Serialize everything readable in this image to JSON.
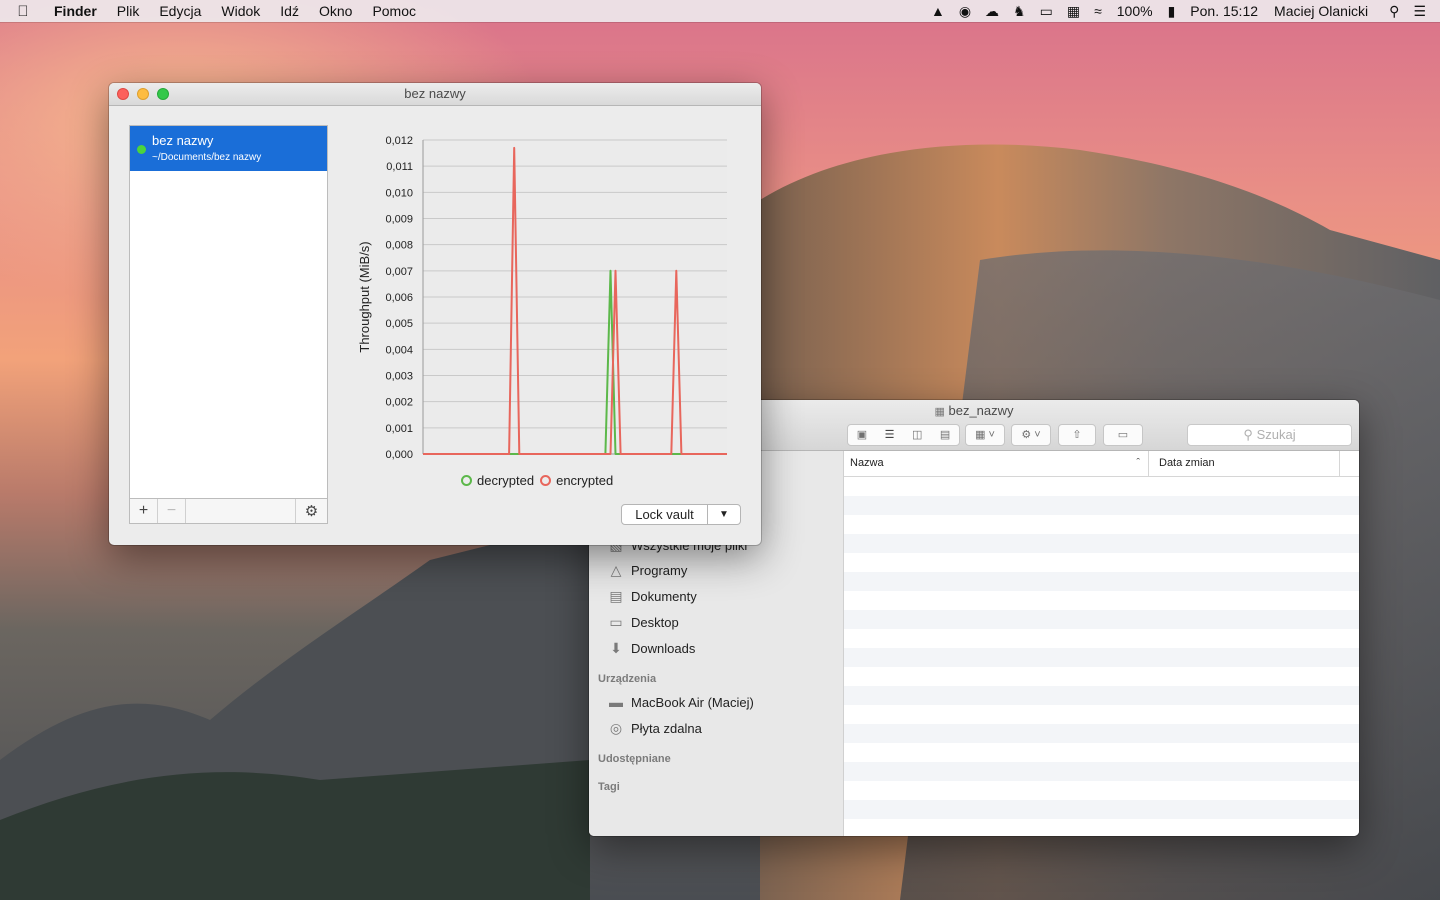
{
  "menubar": {
    "app": "Finder",
    "items": [
      "Plik",
      "Edycja",
      "Widok",
      "Idź",
      "Okno",
      "Pomoc"
    ],
    "battery": "100%",
    "clock": "Pon. 15:12",
    "user": "Maciej Olanicki"
  },
  "crypto": {
    "title": "bez nazwy",
    "vault": {
      "name": "bez nazwy",
      "path": "~/Documents/bez nazwy",
      "status_color": "#4bd43d"
    },
    "lock_label": "Lock vault",
    "add_label": "+",
    "remove_label": "−"
  },
  "chart_data": {
    "type": "line",
    "ylabel": "Throughput (MiB/s)",
    "xlabel": "",
    "ylim": [
      0,
      0.012
    ],
    "yticks": [
      "0,012",
      "0,011",
      "0,010",
      "0,009",
      "0,008",
      "0,007",
      "0,006",
      "0,005",
      "0,004",
      "0,003",
      "0,002",
      "0,001",
      "0,000"
    ],
    "x": [
      0,
      1,
      2,
      3,
      4,
      5,
      6,
      7,
      8,
      9,
      10,
      11,
      12,
      13,
      14,
      15,
      16,
      17,
      18,
      19,
      20,
      21,
      22,
      23,
      24,
      25,
      26,
      27,
      28,
      29,
      30,
      31,
      32,
      33,
      34,
      35,
      36,
      37,
      38,
      39,
      40,
      41,
      42,
      43,
      44,
      45,
      46,
      47,
      48,
      49,
      50,
      51,
      52,
      53,
      54,
      55,
      56,
      57,
      58,
      59,
      60
    ],
    "series": [
      {
        "name": "decrypted",
        "color": "#5cb84a",
        "values": [
          0,
          0,
          0,
          0,
          0,
          0,
          0,
          0,
          0,
          0,
          0,
          0,
          0,
          0,
          0,
          0,
          0,
          0,
          0,
          0,
          0,
          0,
          0,
          0,
          0,
          0,
          0,
          0,
          0,
          0,
          0,
          0,
          0,
          0,
          0,
          0,
          0,
          0.007,
          0,
          0,
          0,
          0,
          0,
          0,
          0,
          0,
          0,
          0,
          0,
          0,
          0,
          0,
          0,
          0,
          0,
          0,
          0,
          0,
          0,
          0,
          0
        ]
      },
      {
        "name": "encrypted",
        "color": "#e8665c",
        "values": [
          0,
          0,
          0,
          0,
          0,
          0,
          0,
          0,
          0,
          0,
          0,
          0,
          0,
          0,
          0,
          0,
          0,
          0,
          0.0117,
          0,
          0,
          0,
          0,
          0,
          0,
          0,
          0,
          0,
          0,
          0,
          0,
          0,
          0,
          0,
          0,
          0,
          0,
          0,
          0.007,
          0,
          0,
          0,
          0,
          0,
          0,
          0,
          0,
          0,
          0,
          0,
          0,
          0,
          0,
          0,
          0,
          0,
          0,
          0,
          0,
          0,
          0
        ]
      }
    ],
    "encrypted_extra_spike": {
      "index": 50,
      "value": 0.007
    },
    "legend_placement": "bottom-center"
  },
  "finder": {
    "title": "bez_nazwy",
    "search_placeholder": "Szukaj",
    "columns": [
      "Nazwa",
      "Data zmian"
    ],
    "sidebar": {
      "partial_item": "Wszystkie moje pliki",
      "favorites": [
        {
          "label": "Programy",
          "icon": "apps-icon"
        },
        {
          "label": "Dokumenty",
          "icon": "document-icon"
        },
        {
          "label": "Desktop",
          "icon": "desktop-icon"
        },
        {
          "label": "Downloads",
          "icon": "downloads-icon"
        }
      ],
      "devices_header": "Urządzenia",
      "devices": [
        {
          "label": "MacBook Air (Maciej)",
          "icon": "laptop-icon"
        },
        {
          "label": "Płyta zdalna",
          "icon": "disc-icon"
        }
      ],
      "shared_header": "Udostępniane",
      "tags_header": "Tagi"
    }
  }
}
